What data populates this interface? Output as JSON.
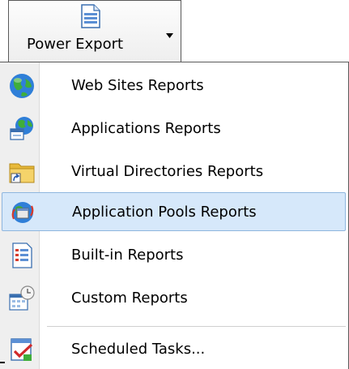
{
  "ribbon": {
    "button_label": "Power Export",
    "button_icon": "document-icon",
    "arrow_icon": "dropdown-arrow-icon"
  },
  "menu": {
    "items": [
      {
        "label": "Web Sites Reports",
        "icon": "globe-icon",
        "highlighted": false
      },
      {
        "label": "Applications Reports",
        "icon": "globe-window-icon",
        "highlighted": false
      },
      {
        "label": "Virtual Directories Reports",
        "icon": "folder-shortcut-icon",
        "highlighted": false
      },
      {
        "label": "Application Pools Reports",
        "icon": "app-pool-icon",
        "highlighted": true
      },
      {
        "label": "Built-in Reports",
        "icon": "report-list-icon",
        "highlighted": false
      },
      {
        "label": "Custom Reports",
        "icon": "calendar-clock-icon",
        "highlighted": false
      },
      {
        "label": "Scheduled Tasks...",
        "icon": "checked-task-icon",
        "highlighted": false
      }
    ]
  },
  "colors": {
    "highlight_bg": "#d6e8fa",
    "highlight_border": "#8eb6de",
    "gutter": "#efefef"
  }
}
